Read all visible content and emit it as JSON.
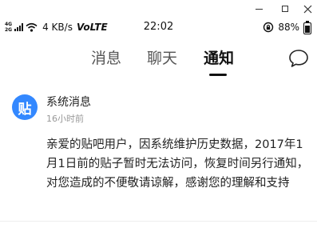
{
  "status_bar": {
    "network_type_top": "4G",
    "network_type_bottom": "2G",
    "net_speed": "4 KB/s",
    "volte": "VoLTE",
    "time": "22:02",
    "battery_percent": "88%",
    "battery_level": 0.88
  },
  "tabs": [
    {
      "label": "消息",
      "active": false
    },
    {
      "label": "聊天",
      "active": false
    },
    {
      "label": "通知",
      "active": true
    }
  ],
  "message": {
    "avatar_glyph": "贴",
    "avatar_color": "#3388ff",
    "sender": "系统消息",
    "time": "16小时前",
    "body": "亲爱的贴吧用户，因系统维护历史数据，2017年1月1日前的贴子暂时无法访问，恢复时间另行通知，对您造成的不便敬请谅解，感谢您的理解和支持"
  }
}
